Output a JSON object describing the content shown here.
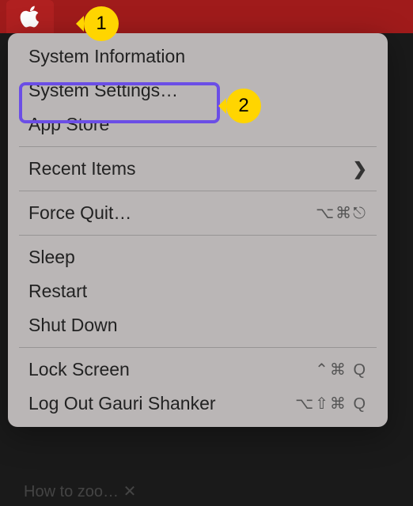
{
  "callouts": {
    "one": "1",
    "two": "2"
  },
  "menu": {
    "system_information": "System Information",
    "system_settings": "System Settings…",
    "app_store": "App Store",
    "recent_items": "Recent Items",
    "recent_chevron": "❯",
    "force_quit": "Force Quit…",
    "force_quit_shortcut": "⌥⌘⎋",
    "sleep": "Sleep",
    "restart": "Restart",
    "shut_down": "Shut Down",
    "lock_screen": "Lock Screen",
    "lock_screen_shortcut": "⌃⌘ Q",
    "log_out": "Log Out Gauri Shanker",
    "log_out_shortcut": "⌥⇧⌘ Q"
  },
  "background": {
    "tab_hint": "How to zoo…  ✕"
  }
}
